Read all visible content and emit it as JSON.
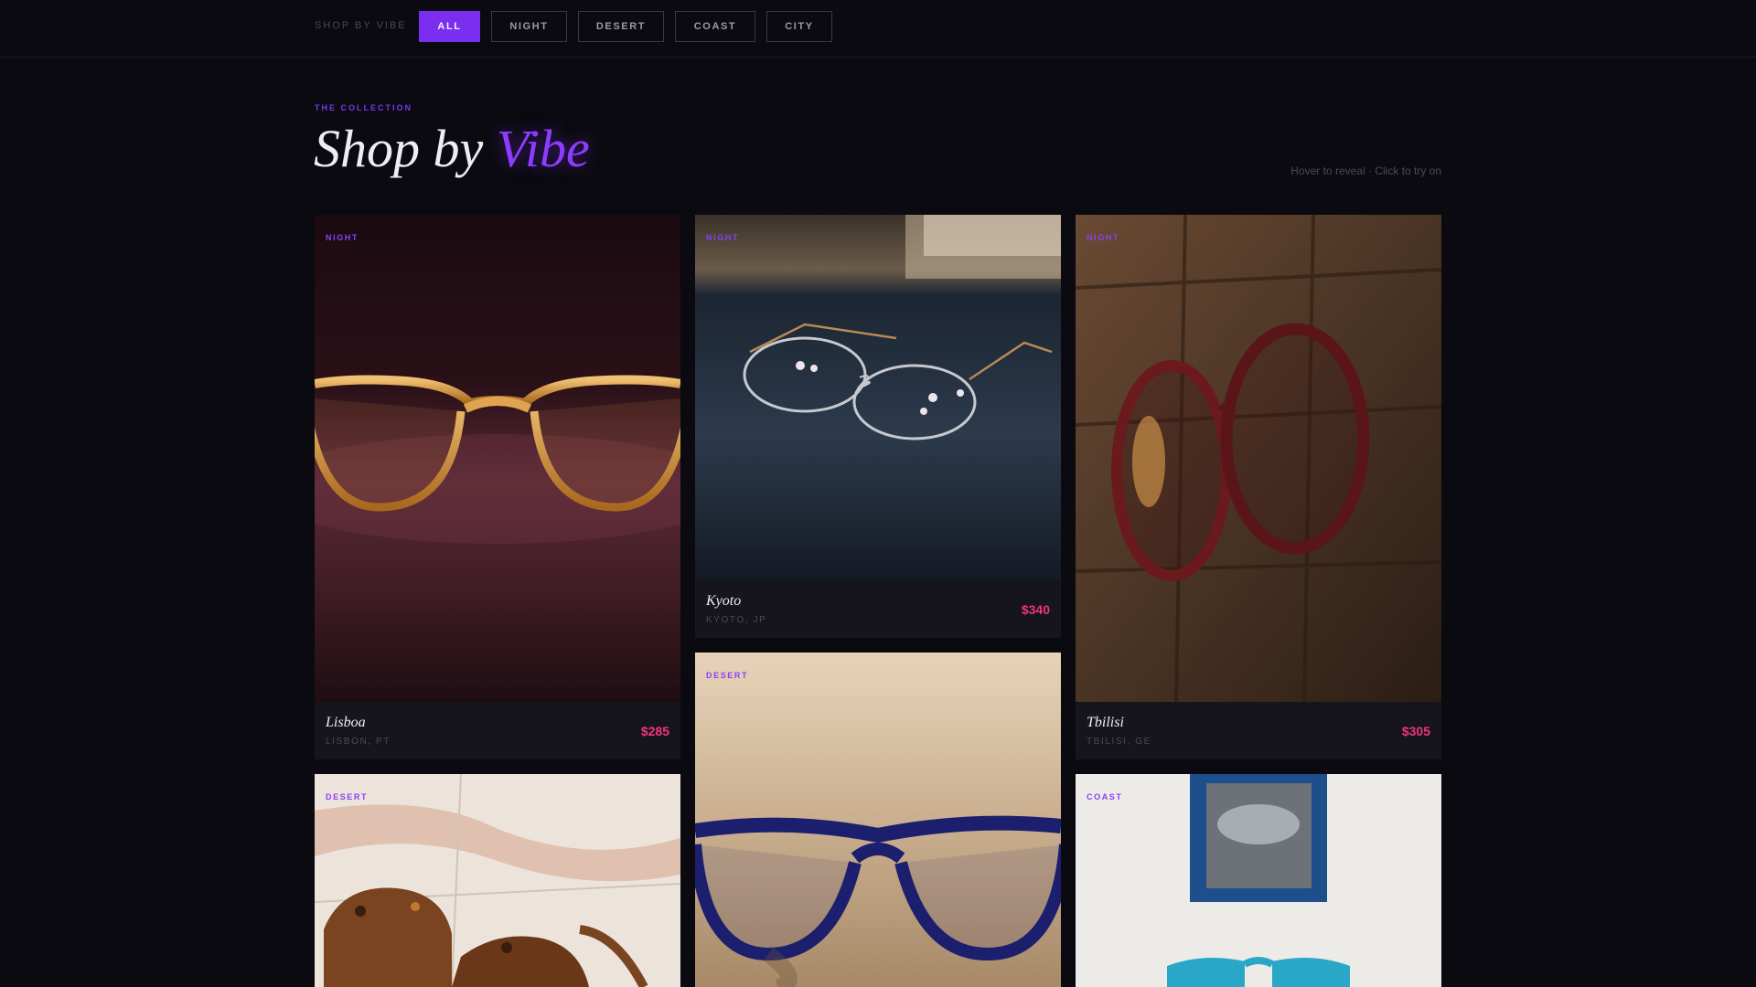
{
  "filters": {
    "label": "SHOP BY VIBE",
    "items": [
      {
        "label": "ALL",
        "active": true
      },
      {
        "label": "NIGHT",
        "active": false
      },
      {
        "label": "DESERT",
        "active": false
      },
      {
        "label": "COAST",
        "active": false
      },
      {
        "label": "CITY",
        "active": false
      }
    ]
  },
  "header": {
    "eyebrow": "THE COLLECTION",
    "title_main": "Shop by",
    "title_accent": "Vibe",
    "hint": "Hover to reveal · Click to try on"
  },
  "products": [
    {
      "tag": "NIGHT",
      "name": "Lisboa",
      "location": "LISBON, PT",
      "price": "$285"
    },
    {
      "tag": "NIGHT",
      "name": "Kyoto",
      "location": "KYOTO, JP",
      "price": "$340"
    },
    {
      "tag": "NIGHT",
      "name": "Tbilisi",
      "location": "TBILISI, GE",
      "price": "$305"
    },
    {
      "tag": "DESERT"
    },
    {
      "tag": "DESERT"
    },
    {
      "tag": "COAST"
    }
  ],
  "colors": {
    "accent": "#7a2ff0",
    "price": "#f0357f",
    "background": "#0b0a10"
  }
}
